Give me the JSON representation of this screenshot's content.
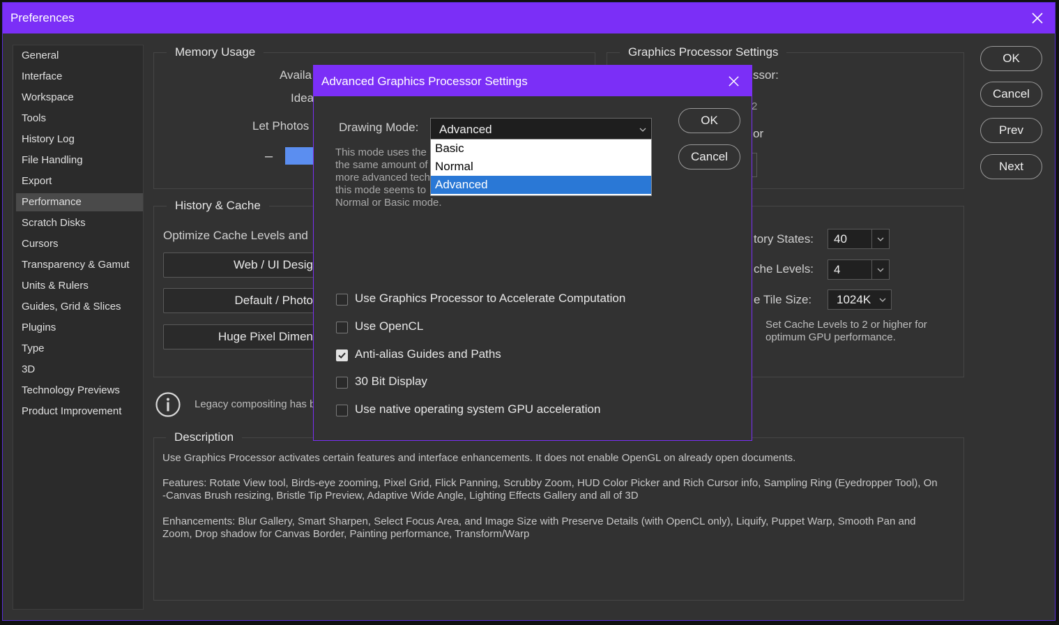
{
  "window": {
    "title": "Preferences"
  },
  "sidebar": {
    "items": [
      {
        "label": "General"
      },
      {
        "label": "Interface"
      },
      {
        "label": "Workspace"
      },
      {
        "label": "Tools"
      },
      {
        "label": "History Log"
      },
      {
        "label": "File Handling"
      },
      {
        "label": "Export"
      },
      {
        "label": "Performance",
        "active": true
      },
      {
        "label": "Scratch Disks"
      },
      {
        "label": "Cursors"
      },
      {
        "label": "Transparency & Gamut"
      },
      {
        "label": "Units & Rulers"
      },
      {
        "label": "Guides, Grid & Slices"
      },
      {
        "label": "Plugins"
      },
      {
        "label": "Type"
      },
      {
        "label": "3D"
      },
      {
        "label": "Technology Previews"
      },
      {
        "label": "Product Improvement"
      }
    ]
  },
  "memory": {
    "legend": "Memory Usage",
    "available_fragment": "Availa",
    "ideal_fragment": "Idea",
    "let_fragment": "Let Photos",
    "minus": "–"
  },
  "gpu": {
    "legend": "Graphics Processor Settings",
    "processor_fragment": "ssor:",
    "or_fragment": "or",
    "small_fragment": "2"
  },
  "history_cache": {
    "legend": "History & Cache",
    "optimize_fragment": "Optimize Cache Levels and",
    "buttons": [
      "Web / UI Desig",
      "Default / Photo",
      "Huge Pixel Dimen"
    ],
    "history_states_label": "tory States:",
    "history_states_value": "40",
    "cache_levels_label": "che Levels:",
    "cache_levels_value": "4",
    "tile_size_label": "e Tile Size:",
    "tile_size_value": "1024K",
    "cache_note": "Set Cache Levels to 2 or higher for\noptimum GPU performance."
  },
  "legacy_fragment": "Legacy compositing has b",
  "description": {
    "legend": "Description",
    "p1": "Use Graphics Processor activates certain features and interface enhancements. It does not enable OpenGL on already open documents.",
    "p2a": "Features: Rotate View tool, Birds-eye zooming, Pixel Grid, Flick Panning, Scrubby Zoom, HUD Color Picker and Rich Cursor info, Sampling Ring (Eyedropper Tool), On",
    "p2b": "-Canvas Brush resizing, Bristle Tip Preview, Adaptive Wide Angle, Lighting Effects Gallery and all of 3D",
    "p3a": "Enhancements: Blur Gallery, Smart Sharpen, Select Focus Area, and Image Size with Preserve Details (with OpenCL only), Liquify, Puppet Warp, Smooth Pan and",
    "p3b": "Zoom, Drop shadow for Canvas Border, Painting performance, Transform/Warp"
  },
  "right_buttons": {
    "ok": "OK",
    "cancel": "Cancel",
    "prev": "Prev",
    "next": "Next"
  },
  "dialog": {
    "title": "Advanced Graphics Processor Settings",
    "drawing_mode_label": "Drawing Mode:",
    "drawing_mode_value": "Advanced",
    "options": [
      "Basic",
      "Normal",
      "Advanced"
    ],
    "selected_option": "Advanced",
    "mode_desc_lines": [
      "This mode uses the",
      "the same amount of",
      "more advanced tech",
      "this mode seems to",
      "Normal or Basic mode."
    ],
    "ok": "OK",
    "cancel": "Cancel",
    "checkboxes": [
      {
        "label": "Use Graphics Processor to Accelerate Computation",
        "checked": false
      },
      {
        "label": "Use OpenCL",
        "checked": false
      },
      {
        "label": "Anti-alias Guides and Paths",
        "checked": true
      },
      {
        "label": "30 Bit Display",
        "checked": false
      },
      {
        "label": "Use native operating system GPU acceleration",
        "checked": false
      }
    ]
  },
  "colors": {
    "accent": "#7b2ff7",
    "select": "#2a78d6",
    "memory_bar": "#5b8ef0"
  }
}
